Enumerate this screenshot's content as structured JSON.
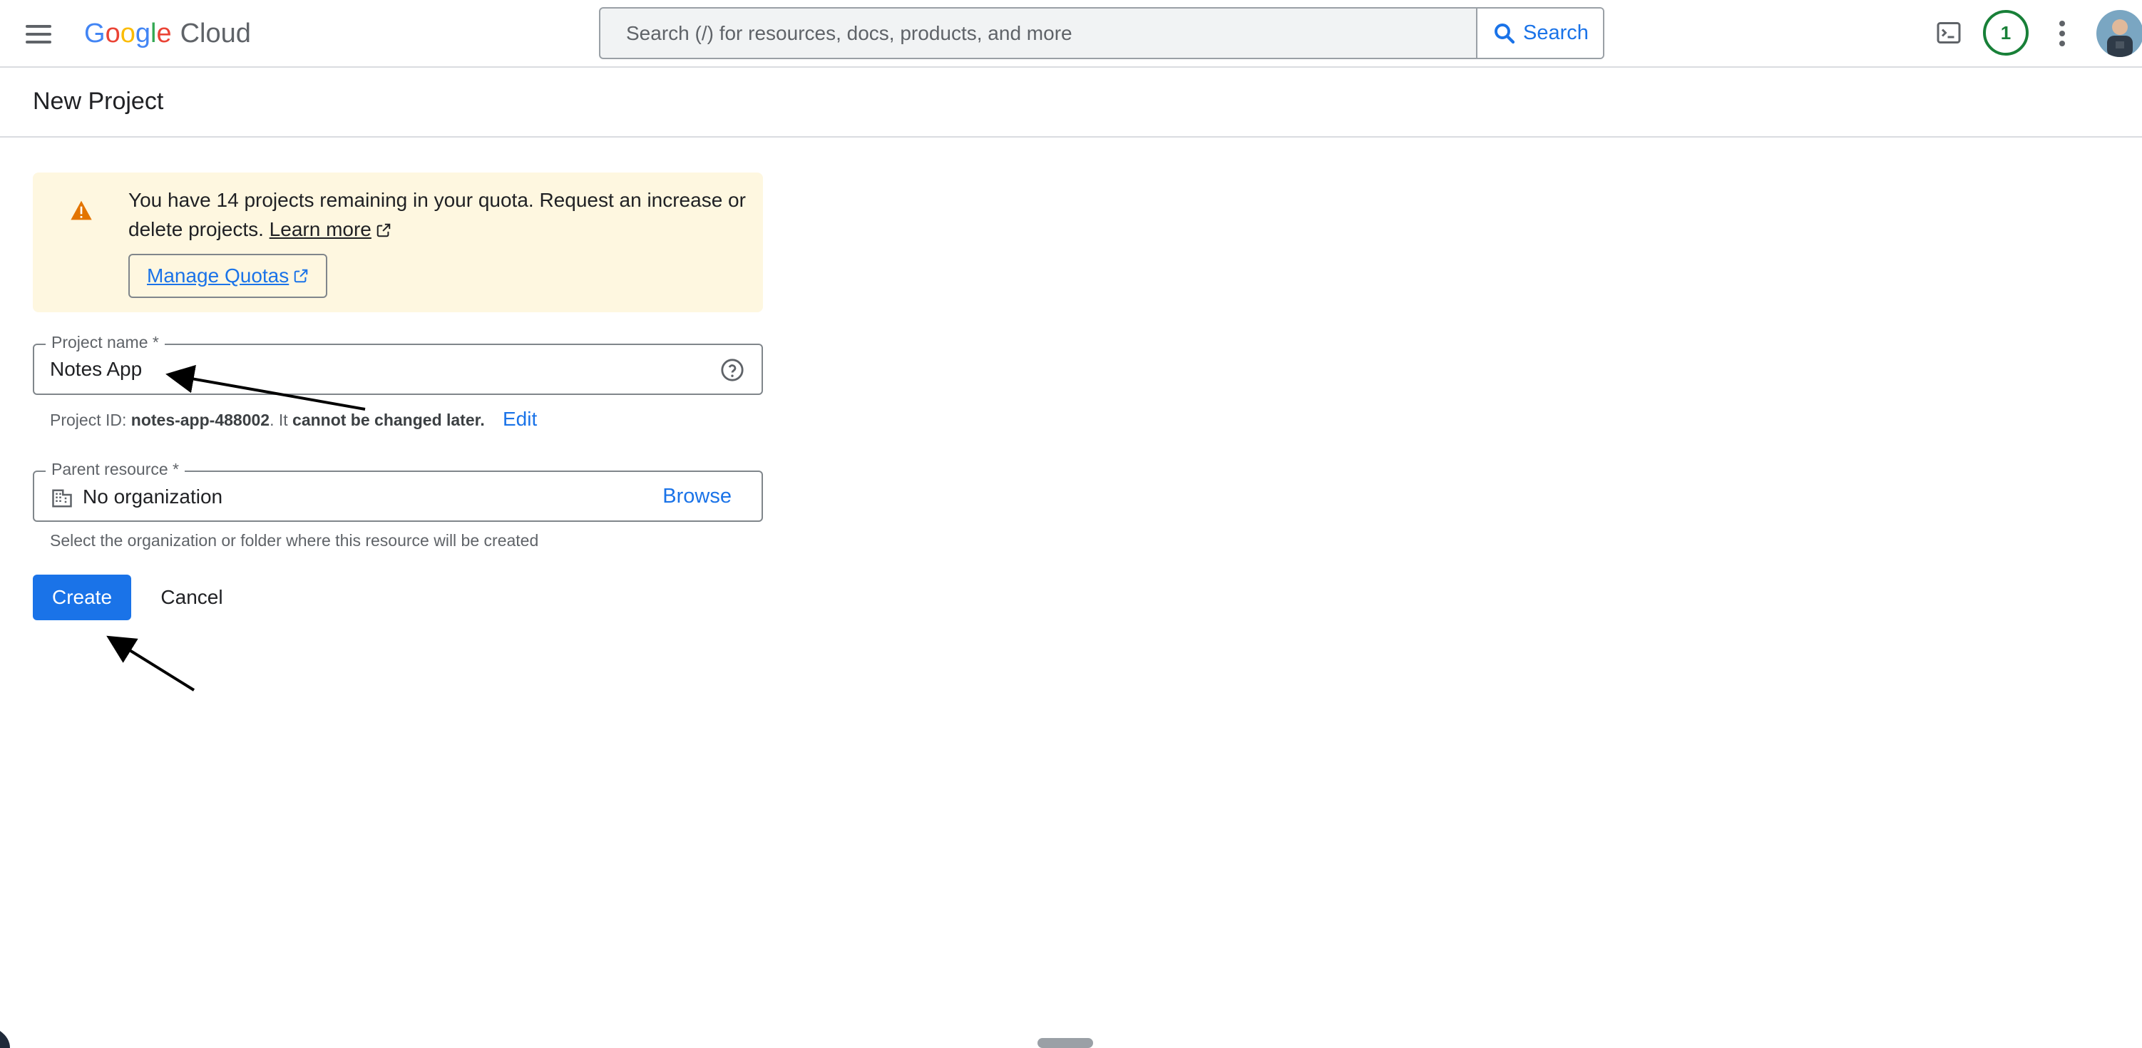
{
  "header": {
    "product": {
      "g1": "G",
      "g2": "o",
      "g3": "o",
      "g4": "g",
      "g5": "l",
      "g6": "e",
      "suffix": "Cloud"
    },
    "search_placeholder": "Search (/) for resources, docs, products, and more",
    "search_button": "Search",
    "notification_count": "1"
  },
  "page": {
    "title": "New Project"
  },
  "quota_banner": {
    "message": "You have 14 projects remaining in your quota. Request an increase or delete projects.",
    "learn_more": "Learn more",
    "manage_quotas": "Manage Quotas"
  },
  "project_name": {
    "label": "Project name *",
    "value": "Notes App",
    "id_prefix": "Project ID:",
    "id_value": "notes-app-488002",
    "id_suffix_1": ". It",
    "id_suffix_2": "cannot be changed later.",
    "edit_label": "Edit"
  },
  "parent_resource": {
    "label": "Parent resource *",
    "value": "No organization",
    "browse_label": "Browse",
    "hint": "Select the organization or folder where this resource will be created"
  },
  "actions": {
    "create": "Create",
    "cancel": "Cancel"
  },
  "colors": {
    "accent": "#1a73e8",
    "banner_bg": "#fef7e0",
    "warning": "#e37400",
    "notification": "#188038"
  }
}
